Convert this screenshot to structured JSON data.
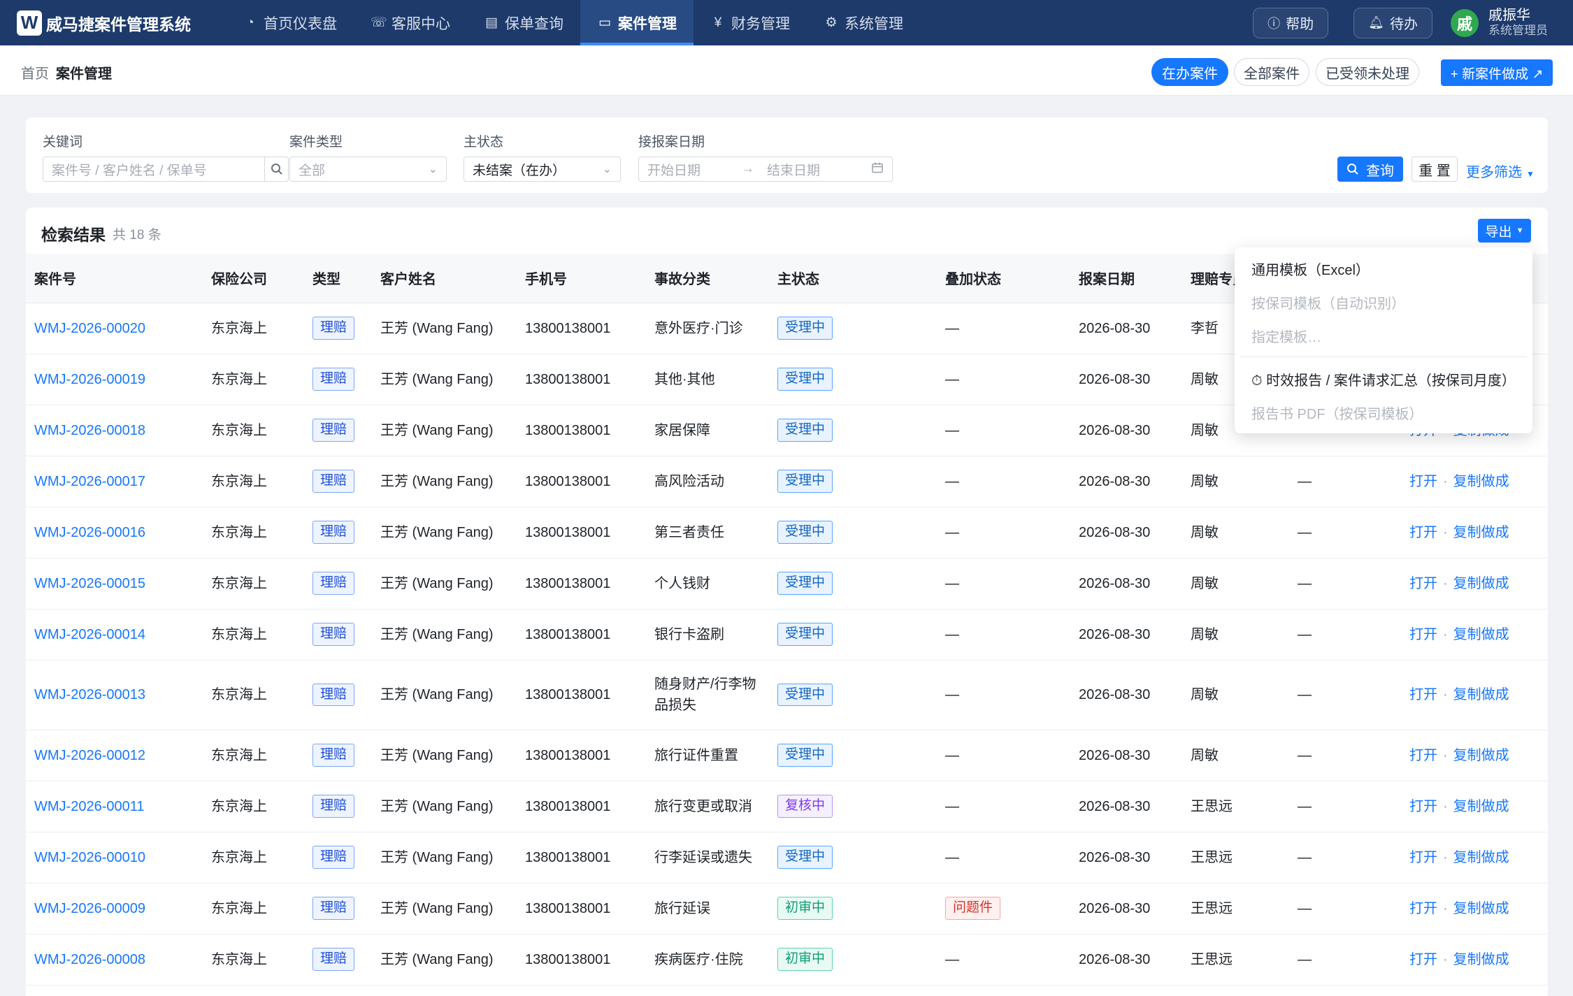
{
  "app": {
    "logo_letter": "W",
    "name": "威马捷案件管理系统"
  },
  "nav": {
    "items": [
      {
        "label": "首页仪表盘",
        "icon": "◔"
      },
      {
        "label": "客服中心",
        "icon": "☏"
      },
      {
        "label": "保单查询",
        "icon": "▤"
      },
      {
        "label": "案件管理",
        "icon": "▭"
      },
      {
        "label": "财务管理",
        "icon": "¥"
      },
      {
        "label": "系统管理",
        "icon": "⚙"
      }
    ],
    "active_index": 3,
    "help_label": "帮助",
    "todo_label": "待办",
    "user_avatar": "戚",
    "user_name": "戚振华",
    "user_role": "系统管理员"
  },
  "breadcrumb": {
    "home": "首页",
    "current": "案件管理"
  },
  "segments": [
    {
      "label": "在办案件",
      "active": true
    },
    {
      "label": "全部案件",
      "active": false
    },
    {
      "label": "已受领未处理",
      "active": false
    }
  ],
  "new_case_button": "+ 新案件做成 ↗",
  "filters": {
    "keyword_label": "关键词",
    "keyword_placeholder": "案件号 / 客户姓名 / 保单号",
    "case_type_label": "案件类型",
    "case_type_value": "全部",
    "status_label": "主状态",
    "status_value": "未结案（在办）",
    "date_label": "接报案日期",
    "start_placeholder": "开始日期",
    "end_placeholder": "结束日期",
    "search_button": "查询",
    "reset_button": "重 置",
    "more_filters": "更多筛选"
  },
  "results": {
    "title": "检索结果",
    "count": "共 18 条",
    "export_button": "导出",
    "columns": [
      "案件号",
      "保险公司",
      "类型",
      "客户姓名",
      "手机号",
      "事故分类",
      "主状态",
      "叠加状态",
      "报案日期",
      "理赔专员",
      "",
      ""
    ],
    "rows": [
      {
        "case_no": "WMJ-2026-00020",
        "company": "东京海上",
        "type": "理赔",
        "customer": "王芳 (Wang Fang)",
        "phone": "13800138001",
        "category": "意外医疗·门诊",
        "status": "受理中",
        "status_kind": "accept",
        "overlay": "—",
        "date": "2026-08-30",
        "adjuster": "李哲",
        "extra": "",
        "actions": true
      },
      {
        "case_no": "WMJ-2026-00019",
        "company": "东京海上",
        "type": "理赔",
        "customer": "王芳 (Wang Fang)",
        "phone": "13800138001",
        "category": "其他·其他",
        "status": "受理中",
        "status_kind": "accept",
        "overlay": "—",
        "date": "2026-08-30",
        "adjuster": "周敏",
        "extra": "",
        "actions": true
      },
      {
        "case_no": "WMJ-2026-00018",
        "company": "东京海上",
        "type": "理赔",
        "customer": "王芳 (Wang Fang)",
        "phone": "13800138001",
        "category": "家居保障",
        "status": "受理中",
        "status_kind": "accept",
        "overlay": "—",
        "date": "2026-08-30",
        "adjuster": "周敏",
        "extra": "",
        "actions": true
      },
      {
        "case_no": "WMJ-2026-00017",
        "company": "东京海上",
        "type": "理赔",
        "customer": "王芳 (Wang Fang)",
        "phone": "13800138001",
        "category": "高风险活动",
        "status": "受理中",
        "status_kind": "accept",
        "overlay": "—",
        "date": "2026-08-30",
        "adjuster": "周敏",
        "extra": "—",
        "actions": true
      },
      {
        "case_no": "WMJ-2026-00016",
        "company": "东京海上",
        "type": "理赔",
        "customer": "王芳 (Wang Fang)",
        "phone": "13800138001",
        "category": "第三者责任",
        "status": "受理中",
        "status_kind": "accept",
        "overlay": "—",
        "date": "2026-08-30",
        "adjuster": "周敏",
        "extra": "—",
        "actions": true
      },
      {
        "case_no": "WMJ-2026-00015",
        "company": "东京海上",
        "type": "理赔",
        "customer": "王芳 (Wang Fang)",
        "phone": "13800138001",
        "category": "个人钱财",
        "status": "受理中",
        "status_kind": "accept",
        "overlay": "—",
        "date": "2026-08-30",
        "adjuster": "周敏",
        "extra": "—",
        "actions": true
      },
      {
        "case_no": "WMJ-2026-00014",
        "company": "东京海上",
        "type": "理赔",
        "customer": "王芳 (Wang Fang)",
        "phone": "13800138001",
        "category": "银行卡盗刷",
        "status": "受理中",
        "status_kind": "accept",
        "overlay": "—",
        "date": "2026-08-30",
        "adjuster": "周敏",
        "extra": "—",
        "actions": true
      },
      {
        "case_no": "WMJ-2026-00013",
        "company": "东京海上",
        "type": "理赔",
        "customer": "王芳 (Wang Fang)",
        "phone": "13800138001",
        "category": "随身财产/行李物品损失",
        "status": "受理中",
        "status_kind": "accept",
        "overlay": "—",
        "date": "2026-08-30",
        "adjuster": "周敏",
        "extra": "—",
        "actions": true,
        "tall": true
      },
      {
        "case_no": "WMJ-2026-00012",
        "company": "东京海上",
        "type": "理赔",
        "customer": "王芳 (Wang Fang)",
        "phone": "13800138001",
        "category": "旅行证件重置",
        "status": "受理中",
        "status_kind": "accept",
        "overlay": "—",
        "date": "2026-08-30",
        "adjuster": "周敏",
        "extra": "—",
        "actions": true
      },
      {
        "case_no": "WMJ-2026-00011",
        "company": "东京海上",
        "type": "理赔",
        "customer": "王芳 (Wang Fang)",
        "phone": "13800138001",
        "category": "旅行变更或取消",
        "status": "复核中",
        "status_kind": "review",
        "overlay": "—",
        "date": "2026-08-30",
        "adjuster": "王思远",
        "extra": "—",
        "actions": true
      },
      {
        "case_no": "WMJ-2026-00010",
        "company": "东京海上",
        "type": "理赔",
        "customer": "王芳 (Wang Fang)",
        "phone": "13800138001",
        "category": "行李延误或遗失",
        "status": "受理中",
        "status_kind": "accept",
        "overlay": "—",
        "date": "2026-08-30",
        "adjuster": "王思远",
        "extra": "—",
        "actions": true
      },
      {
        "case_no": "WMJ-2026-00009",
        "company": "东京海上",
        "type": "理赔",
        "customer": "王芳 (Wang Fang)",
        "phone": "13800138001",
        "category": "旅行延误",
        "status": "初审中",
        "status_kind": "initial",
        "overlay": "问题件",
        "date": "2026-08-30",
        "adjuster": "王思远",
        "extra": "—",
        "actions": true
      },
      {
        "case_no": "WMJ-2026-00008",
        "company": "东京海上",
        "type": "理赔",
        "customer": "王芳 (Wang Fang)",
        "phone": "13800138001",
        "category": "疾病医疗·住院",
        "status": "初审中",
        "status_kind": "initial",
        "overlay": "—",
        "date": "2026-08-30",
        "adjuster": "王思远",
        "extra": "—",
        "actions": true
      }
    ],
    "action_open": "打开",
    "action_copy": "复制做成"
  },
  "export_menu": {
    "items": [
      {
        "label": "通用模板（Excel）",
        "disabled": false
      },
      {
        "label": "按保司模板（自动识别）",
        "disabled": true
      },
      {
        "label": "指定模板…",
        "disabled": true
      },
      {
        "label": "⏱ 时效报告 / 案件请求汇总（按保司月度）",
        "disabled": false
      },
      {
        "label": "报告书 PDF（按保司模板）",
        "disabled": true
      }
    ]
  }
}
